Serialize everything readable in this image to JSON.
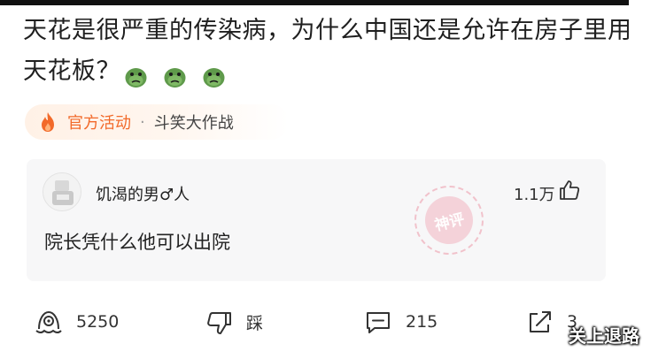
{
  "question": {
    "title": "天花是很严重的传染病，为什么中国还是允许在房子里用天花板？",
    "emoji_count": 3
  },
  "activity": {
    "label": "官方活动",
    "separator": "·",
    "name": "斗笑大作战"
  },
  "comment": {
    "user": "饥渴的男♂人",
    "likes": "1.1万",
    "text": "院长凭什么他可以出院",
    "stamp": "神评"
  },
  "actions": {
    "reward_count": "5250",
    "dislike_label": "踩",
    "comment_count": "215",
    "share_count": "3"
  },
  "watermark": "关上退路",
  "colors": {
    "accent": "#f26a2a",
    "card_bg": "#f7f7f8",
    "stamp": "#ee8ca0",
    "dino": "#5f9a4b"
  },
  "icons": [
    "fire-icon",
    "thumbs-up-icon",
    "reward-icon",
    "thumbs-down-icon",
    "comment-icon",
    "share-icon",
    "dinosaur-emoji-icon"
  ]
}
